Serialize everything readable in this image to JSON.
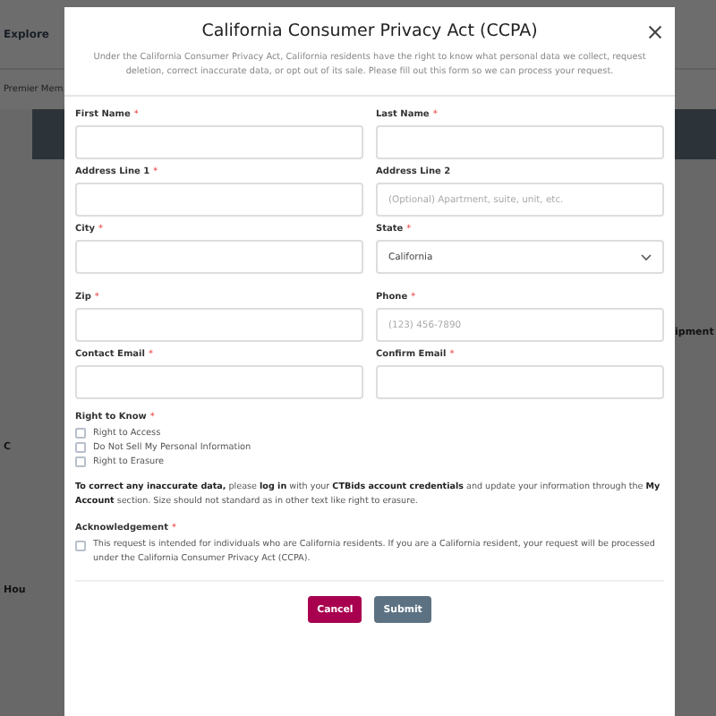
{
  "background": {
    "nav_label": "Explore",
    "tab_label": "Premier Mem",
    "side_text": "ipment",
    "heading_text": "Hou",
    "letter_text": "C"
  },
  "dialog": {
    "title": "California Consumer Privacy Act (CCPA)",
    "description": "Under the California Consumer Privacy Act, California residents have the right to know what personal data we collect, request deletion, correct inaccurate data, or opt out of its sale. Please fill out this form so we can process your request.",
    "fields": [
      {
        "label": "First Name",
        "required": true,
        "kind": "input"
      },
      {
        "label": "Last Name",
        "required": true,
        "kind": "input"
      },
      {
        "label": "Address Line 1",
        "required": true,
        "kind": "input"
      },
      {
        "label": "Address Line 2",
        "required": false,
        "kind": "input",
        "placeholder": "(Optional) Apartment, suite, unit, etc."
      },
      {
        "label": "City",
        "required": true,
        "kind": "input"
      },
      {
        "label": "State",
        "required": true,
        "kind": "select",
        "value": "California"
      },
      {
        "label": "Zip",
        "required": true,
        "kind": "input"
      },
      {
        "label": "Phone",
        "required": true,
        "kind": "input",
        "placeholder": "(123) 456-7890"
      },
      {
        "label": "Contact Email",
        "required": true,
        "kind": "input"
      },
      {
        "label": "Confirm Email",
        "required": true,
        "kind": "input"
      }
    ],
    "rights": {
      "label": "Right to Know",
      "required": true,
      "options": [
        {
          "label": "Right to Access",
          "checked": false
        },
        {
          "label": "Do Not Sell My Personal Information",
          "checked": false
        },
        {
          "label": "Right to Erasure",
          "checked": false
        }
      ]
    },
    "note": "**To correct any inaccurate data,** please **log in** with your **CTBids account credentials** and update your information through the **My Account** section. Size should not standard as in other text like right to erasure.",
    "acknowledgement": {
      "label": "Acknowledgement",
      "required": true,
      "text": "This request is intended for individuals who are California residents. If you are a California resident, your request will be processed under the California Consumer Privacy Act (CCPA).",
      "checked": false
    },
    "buttons": [
      {
        "label": "Cancel",
        "kind": "cancel"
      },
      {
        "label": "Submit",
        "kind": "submit"
      }
    ],
    "required_mark": "*"
  }
}
